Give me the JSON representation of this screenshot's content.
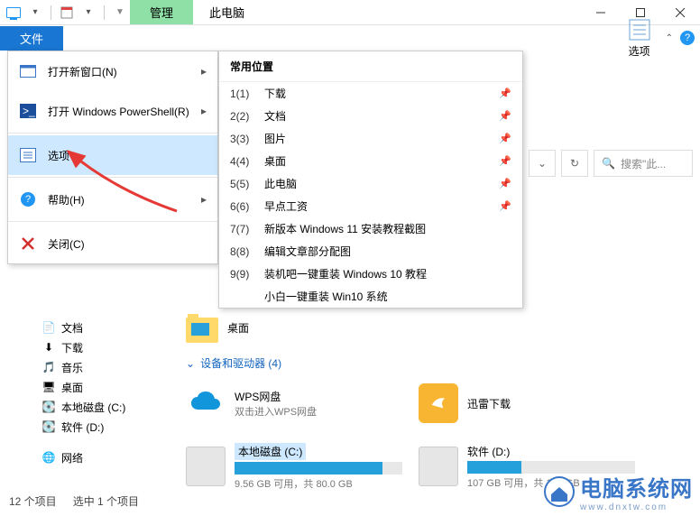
{
  "titlebar": {
    "tab_manage": "管理",
    "title": "此电脑"
  },
  "ribbon": {
    "file": "文件",
    "options": "选项",
    "search_placeholder": "搜索\"此..."
  },
  "file_menu": {
    "new_window": "打开新窗口(N)",
    "powershell": "打开 Windows PowerShell(R)",
    "options": "选项",
    "help": "帮助(H)",
    "close": "关闭(C)"
  },
  "submenu": {
    "header": "常用位置",
    "items": [
      {
        "key": "1(1)",
        "label": "下载",
        "pinned": true
      },
      {
        "key": "2(2)",
        "label": "文档",
        "pinned": true
      },
      {
        "key": "3(3)",
        "label": "图片",
        "pinned": true
      },
      {
        "key": "4(4)",
        "label": "桌面",
        "pinned": true
      },
      {
        "key": "5(5)",
        "label": "此电脑",
        "pinned": true
      },
      {
        "key": "6(6)",
        "label": "早点工资",
        "pinned": true
      },
      {
        "key": "7(7)",
        "label": "新版本 Windows 11 安装教程截图",
        "pinned": false
      },
      {
        "key": "8(8)",
        "label": "编辑文章部分配图",
        "pinned": false
      },
      {
        "key": "9(9)",
        "label": "装机吧一键重装 Windows 10 教程",
        "pinned": false
      },
      {
        "key": "",
        "label": "小白一键重装 Win10 系统",
        "pinned": false
      }
    ]
  },
  "tree": {
    "items": [
      {
        "icon": "doc",
        "label": "文档"
      },
      {
        "icon": "download",
        "label": "下载"
      },
      {
        "icon": "music",
        "label": "音乐"
      },
      {
        "icon": "desktop",
        "label": "桌面"
      },
      {
        "icon": "drive",
        "label": "本地磁盘 (C:)"
      },
      {
        "icon": "drive",
        "label": "软件 (D:)"
      },
      {
        "icon": "network",
        "label": "网络"
      }
    ]
  },
  "content": {
    "crumb": "桌面",
    "section": "设备和驱动器 (4)",
    "wps": {
      "title": "WPS网盘",
      "sub": "双击进入WPS网盘"
    },
    "xunlei": {
      "title": "迅雷下载"
    },
    "drive_c": {
      "title": "本地磁盘 (C:)",
      "sub": "9.56 GB 可用，共 80.0 GB",
      "fill": 88
    },
    "drive_d": {
      "title": "软件 (D:)",
      "sub": "107 GB 可用，共 158 GB",
      "fill": 32
    }
  },
  "status": {
    "count": "12 个项目",
    "selected": "选中 1 个项目"
  },
  "watermark": {
    "big": "电脑系统网",
    "small": "www.dnxtw.com"
  }
}
